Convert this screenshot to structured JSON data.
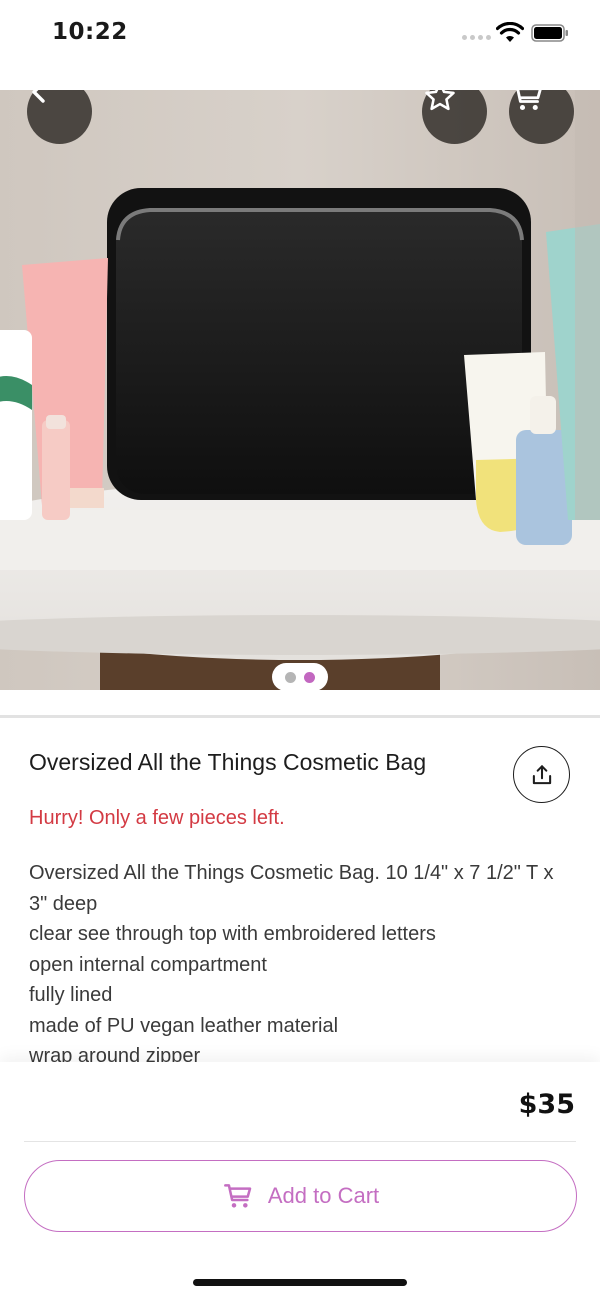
{
  "status_bar": {
    "time": "10:22"
  },
  "header": {
    "back_icon": "chevron-left-icon",
    "favorite_icon": "star-icon",
    "cart_icon": "cart-icon"
  },
  "gallery": {
    "image_count": 2,
    "active_index": 1
  },
  "product": {
    "title": "Oversized All the Things Cosmetic Bag",
    "stock_warning": "Hurry! Only a few pieces left.",
    "description_lines": [
      "Oversized All the Things Cosmetic Bag. 10 1/4\" x 7 1/2\" T x 3\" deep",
      "clear see through top with embroidered letters",
      "open internal compartment",
      "fully lined",
      "made of PU vegan leather material",
      "wrap around zipper"
    ],
    "price": "$35"
  },
  "actions": {
    "share_icon": "share-icon",
    "add_to_cart_label": "Add to Cart"
  },
  "colors": {
    "accent": "#c46ec2",
    "warning": "#d33a43"
  }
}
